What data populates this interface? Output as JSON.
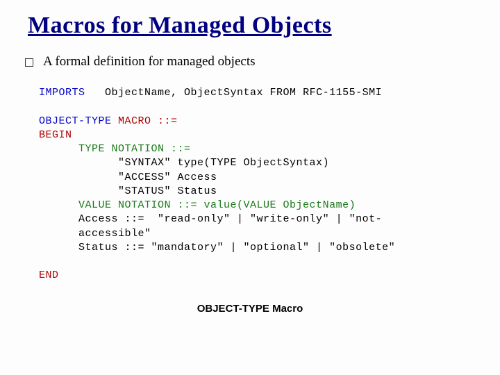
{
  "title": "Macros for Managed Objects",
  "bullet": "A formal definition for managed objects",
  "code": {
    "imports_kw": "IMPORTS",
    "imports_rest": "   ObjectName, ObjectSyntax FROM RFC-1155-SMI",
    "objtype": "OBJECT-TYPE",
    "macro_eq": " MACRO ::=",
    "begin": "BEGIN",
    "type_notation": "      TYPE NOTATION ::=",
    "syntax_line": "            \"SYNTAX\" type(TYPE ObjectSyntax)",
    "access_line": "            \"ACCESS\" Access",
    "status_line": "            \"STATUS\" Status",
    "value_notation": "      VALUE NOTATION ::= value(VALUE ObjectName)",
    "access_def1": "      Access ::=  \"read-only\" | \"write-only\" | \"not-",
    "access_def2": "      accessible\"",
    "status_def": "      Status ::= \"mandatory\" | \"optional\" | \"obsolete\"",
    "end": "END"
  },
  "caption": "OBJECT-TYPE Macro"
}
